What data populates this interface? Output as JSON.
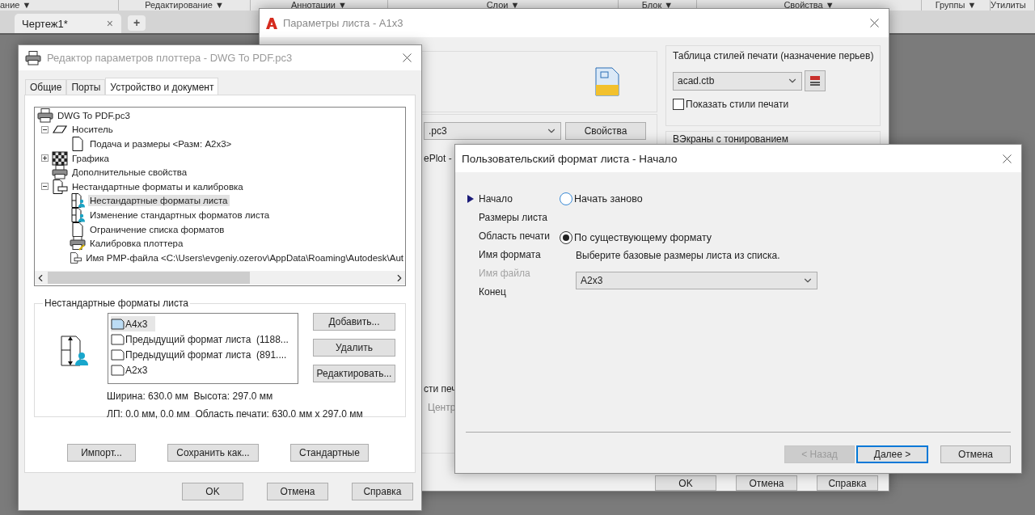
{
  "ribbon_panels": [
    "ание ▼",
    "Редактирование ▼",
    "Аннотации ▼",
    "Слои ▼",
    "Блок ▼",
    "Свойства ▼",
    "Группы ▼",
    "Утилиты"
  ],
  "document_tabs": [
    {
      "label": "Чертеж1*",
      "selected": true,
      "close": "×"
    }
  ],
  "new_tab": "+",
  "page_setup": {
    "title": "Параметры листа - A1x3",
    "plotter": {
      "value": ".pc3",
      "button": "Свойства"
    },
    "plotter_note": "ePlot -",
    "offset_label": "сти печ",
    "center_option": {
      "label": "Центр",
      "disabled": true
    },
    "style_table": {
      "title": "Таблица стилей печати (назначение перьев)",
      "value": "acad.ctb",
      "show_styles": {
        "label": "Показать стили печати",
        "checked": false
      }
    },
    "shaded_viewports": {
      "title": "ВЭкраны с тонированием"
    },
    "buttons": [
      "OK",
      "Отмена",
      "Справка"
    ]
  },
  "plotter_editor": {
    "title": "Редактор параметров плоттера - DWG To PDF.pc3",
    "tabs": [
      {
        "label": "Общие",
        "selected": false
      },
      {
        "label": "Порты",
        "selected": false
      },
      {
        "label": "Устройство и документ",
        "selected": true
      }
    ],
    "tree": [
      {
        "label": "DWG To PDF.pc3",
        "selected": false,
        "children": [
          {
            "label": "Носитель",
            "selected": false,
            "expanded": true,
            "children": [
              {
                "label": "Подача и размеры <Разм: A2x3>",
                "selected": false
              }
            ]
          },
          {
            "label": "Графика",
            "selected": false,
            "expanded": false
          },
          {
            "label": "Дополнительные свойства",
            "selected": false
          },
          {
            "label": "Нестандартные форматы и калибровка",
            "selected": false,
            "expanded": true,
            "children": [
              {
                "label": "Нестандартные форматы листа",
                "selected": true
              },
              {
                "label": "Изменение стандартных форматов листа",
                "selected": false
              },
              {
                "label": "Ограничение списка форматов",
                "selected": false
              },
              {
                "label": "Калибровка плоттера",
                "selected": false
              },
              {
                "label": "Имя PMP-файла <C:\\Users\\evgeniy.ozerov\\AppData\\Roaming\\Autodesk\\Aut",
                "selected": false
              }
            ]
          }
        ]
      }
    ],
    "custom_sizes": {
      "title": "Нестандартные форматы листа",
      "items": [
        {
          "label": "A4x3",
          "selected": true
        },
        {
          "label": "Предыдущий формат листа  (1188...",
          "selected": false
        },
        {
          "label": "Предыдущий формат листа  (891....",
          "selected": false
        },
        {
          "label": "A2x3",
          "selected": false
        }
      ],
      "buttons": [
        "Добавить...",
        "Удалить",
        "Редактировать..."
      ],
      "size_info": "Ширина: 630.0 мм  Высота: 297.0 мм",
      "area_info": "ЛП: 0.0 мм, 0.0 мм  Область печати: 630.0 мм x 297.0 мм"
    },
    "actions": [
      "Импорт...",
      "Сохранить как...",
      "Стандартные"
    ],
    "buttons": [
      "OK",
      "Отмена",
      "Справка"
    ]
  },
  "wizard": {
    "title": "Пользовательский формат листа - Начало",
    "steps": [
      {
        "label": "Начало",
        "selected": true,
        "disabled": false
      },
      {
        "label": "Размеры листа",
        "selected": false,
        "disabled": false
      },
      {
        "label": "Область печати",
        "selected": false,
        "disabled": false
      },
      {
        "label": "Имя формата",
        "selected": false,
        "disabled": false
      },
      {
        "label": "Имя файла",
        "selected": false,
        "disabled": true
      },
      {
        "label": "Конец",
        "selected": false,
        "disabled": false
      }
    ],
    "options": [
      {
        "label": "Начать заново",
        "selected": false
      },
      {
        "label": "По существующему формату",
        "selected": true,
        "hint": "Выберите базовые размеры листа из списка.",
        "base_size": "A2x3"
      }
    ],
    "buttons": [
      {
        "label": "< Назад",
        "disabled": true,
        "default": false
      },
      {
        "label": "Далее >",
        "disabled": false,
        "default": true
      },
      {
        "label": "Отмена",
        "disabled": false,
        "default": false
      }
    ]
  }
}
